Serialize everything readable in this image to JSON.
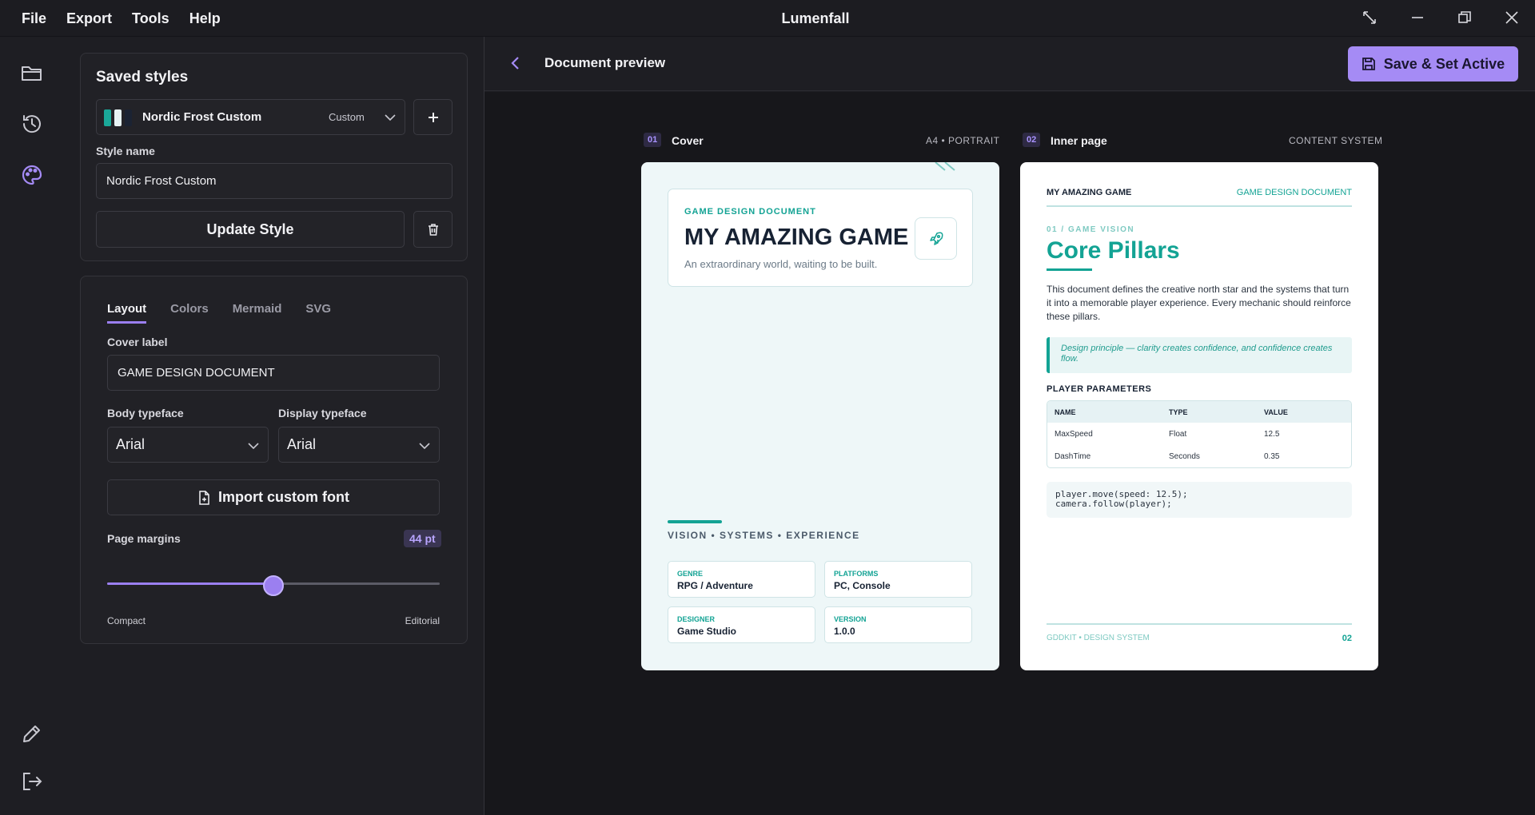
{
  "app": {
    "title": "Lumenfall"
  },
  "menu": [
    "File",
    "Export",
    "Tools",
    "Help"
  ],
  "rail": {
    "icons": [
      "folder-icon",
      "history-icon",
      "palette-icon",
      "pencil-icon",
      "logout-icon"
    ]
  },
  "saved_styles": {
    "heading": "Saved styles",
    "selected_name": "Nordic Frost Custom",
    "selected_tag": "Custom",
    "swatches": [
      "#1aa899",
      "#e8f3f5",
      "#1b2333"
    ],
    "name_label": "Style name",
    "name_value": "Nordic Frost Custom",
    "update_label": "Update Style"
  },
  "settings": {
    "tabs": [
      "Layout",
      "Colors",
      "Mermaid",
      "SVG"
    ],
    "active_tab": "Layout",
    "cover_label_title": "Cover label",
    "cover_label_value": "GAME DESIGN DOCUMENT",
    "body_typeface_label": "Body typeface",
    "body_typeface_value": "Arial",
    "display_typeface_label": "Display typeface",
    "display_typeface_value": "Arial",
    "import_font_label": "Import custom font",
    "margins_label": "Page margins",
    "margins_value": "44 pt",
    "margins_fraction": 0.5,
    "min_label": "Compact",
    "max_label": "Editorial"
  },
  "preview": {
    "title": "Document preview",
    "save_label": "Save & Set Active",
    "accent": "#a58bf5"
  },
  "pages": {
    "cover": {
      "num": "01",
      "label": "Cover",
      "meta": "A4 • PORTRAIT",
      "doc_label": "GAME DESIGN DOCUMENT",
      "title": "MY AMAZING GAME",
      "subtitle": "An extraordinary world, waiting to be built.",
      "tagline": "VISION • SYSTEMS • EXPERIENCE",
      "meta_cards": [
        {
          "key": "GENRE",
          "value": "RPG / Adventure"
        },
        {
          "key": "PLATFORMS",
          "value": "PC, Console"
        },
        {
          "key": "DESIGNER",
          "value": "Game Studio"
        },
        {
          "key": "VERSION",
          "value": "1.0.0"
        }
      ]
    },
    "inner": {
      "num": "02",
      "label": "Inner page",
      "meta": "CONTENT SYSTEM",
      "header_left": "MY AMAZING GAME",
      "header_right": "GAME DESIGN DOCUMENT",
      "section": "01 / GAME VISION",
      "heading": "Core Pillars",
      "paragraph": "This document defines the creative north star and the systems that turn it into a memorable player experience. Every mechanic should reinforce these pillars.",
      "quote": "Design principle — clarity creates confidence, and confidence creates flow.",
      "table_title": "PLAYER PARAMETERS",
      "table_headers": [
        "NAME",
        "TYPE",
        "VALUE"
      ],
      "table_rows": [
        [
          "MaxSpeed",
          "Float",
          "12.5"
        ],
        [
          "DashTime",
          "Seconds",
          "0.35"
        ]
      ],
      "code": "player.move(speed: 12.5);\ncamera.follow(player);",
      "footer_left": "GDDKIT • DESIGN SYSTEM",
      "footer_right": "02"
    }
  }
}
